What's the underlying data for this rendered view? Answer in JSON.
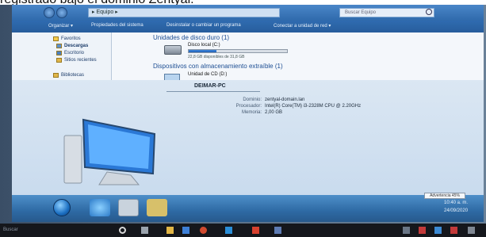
{
  "caption": "registrado bajo el dominio Zentyal.",
  "explorer": {
    "address": "▸ Equipo ▸",
    "search_placeholder": "Buscar Equipo",
    "toolbar": [
      "Organizar ▾",
      "Propiedades del sistema",
      "Desinstalar o cambiar un programa",
      "Conectar a unidad de red ▾"
    ],
    "nav": [
      {
        "label": "Favoritos",
        "icon": "star-icon"
      },
      {
        "label": "Descargas",
        "icon": "downloads-folder-icon"
      },
      {
        "label": "Escritorio",
        "icon": "desktop-icon"
      },
      {
        "label": "Sitios recientes",
        "icon": "recent-places-icon"
      },
      {
        "label": "Bibliotecas",
        "icon": "libraries-icon"
      }
    ],
    "hard_disks_header": "Unidades de disco duro (1)",
    "drive": {
      "name": "Disco local (C:)",
      "free_text": "22,8 GB disponibles de 31,8 GB",
      "used_fraction": 0.28
    },
    "removable_header": "Dispositivos con almacenamiento extraíble (1)",
    "cd_drive": {
      "name": "Unidad de CD (D:)"
    },
    "details": {
      "pc_name": "DEIMAR-PC",
      "rows": [
        {
          "label": "Dominio:",
          "value": "zentyal-domain.lan"
        },
        {
          "label": "Procesador:",
          "value": "Intel(R) Core(TM) i3-2328M CPU @ 2.20GHz"
        },
        {
          "label": "Memoria:",
          "value": "2,00 GB"
        }
      ]
    }
  },
  "taskbar": {
    "tooltip": "Advertencia 45%",
    "clock_time": "10:40 a. m.",
    "clock_date": "24/09/2020"
  },
  "physical_taskbar": {
    "label": "Buscar"
  }
}
